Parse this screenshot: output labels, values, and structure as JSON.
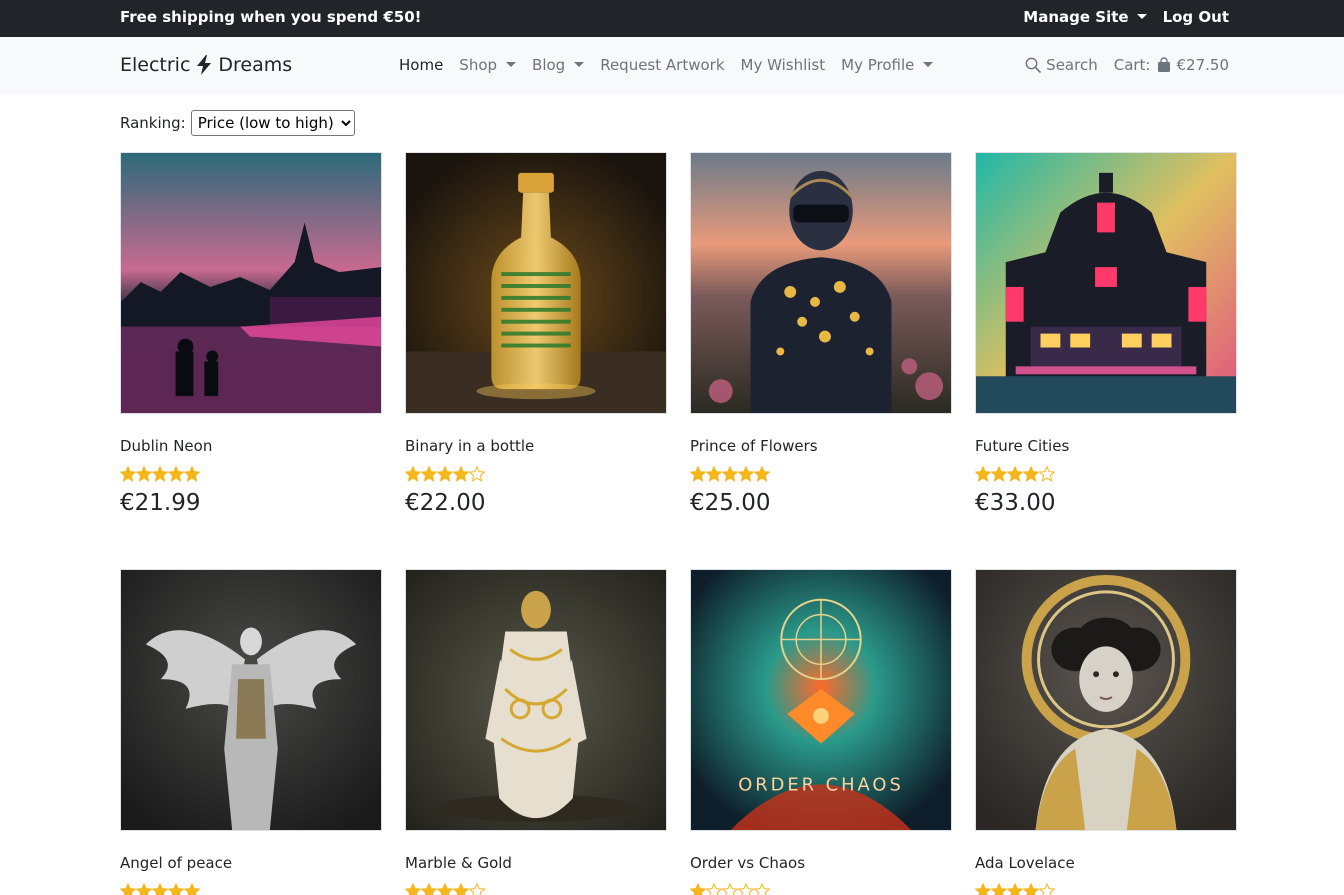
{
  "promo": {
    "text": "Free shipping when you spend €50!",
    "manage": "Manage Site",
    "logout": "Log Out"
  },
  "navbar": {
    "brand_left": "Electric",
    "brand_right": "Dreams",
    "links": [
      "Home",
      "Shop",
      "Blog",
      "Request Artwork",
      "My Wishlist",
      "My Profile"
    ],
    "search": "Search",
    "cart_label": "Cart:",
    "cart_total": "€27.50"
  },
  "ranking": {
    "label": "Ranking:",
    "selected": "Price (low to high)"
  },
  "colors": {
    "star": "#f4b61b",
    "dark": "#212529",
    "muted": "#6c757d"
  },
  "products": [
    {
      "title": "Dublin Neon",
      "rating": 5,
      "price": "€21.99"
    },
    {
      "title": "Binary in a bottle",
      "rating": 4,
      "price": "€22.00"
    },
    {
      "title": "Prince of Flowers",
      "rating": 5,
      "price": "€25.00"
    },
    {
      "title": "Future Cities",
      "rating": 4,
      "price": "€33.00"
    },
    {
      "title": "Angel of peace",
      "rating": 5,
      "price": ""
    },
    {
      "title": "Marble & Gold",
      "rating": 4,
      "price": ""
    },
    {
      "title": "Order vs Chaos",
      "rating": 1,
      "price": ""
    },
    {
      "title": "Ada Lovelace",
      "rating": 4,
      "price": ""
    }
  ],
  "artwork_text": {
    "order_chaos": "ORDER CHAOS"
  }
}
